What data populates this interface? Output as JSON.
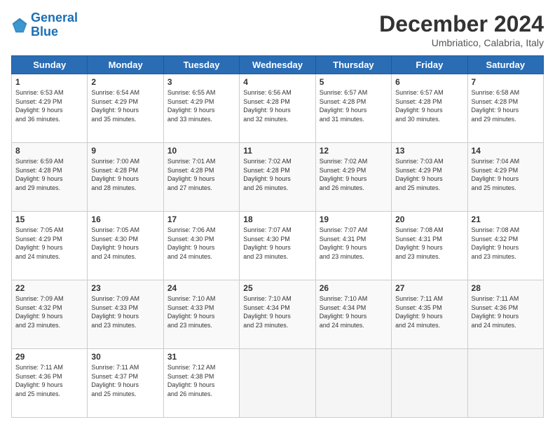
{
  "logo": {
    "line1": "General",
    "line2": "Blue"
  },
  "title": "December 2024",
  "subtitle": "Umbriatico, Calabria, Italy",
  "days_header": [
    "Sunday",
    "Monday",
    "Tuesday",
    "Wednesday",
    "Thursday",
    "Friday",
    "Saturday"
  ],
  "weeks": [
    [
      {
        "day": "1",
        "info": "Sunrise: 6:53 AM\nSunset: 4:29 PM\nDaylight: 9 hours\nand 36 minutes."
      },
      {
        "day": "2",
        "info": "Sunrise: 6:54 AM\nSunset: 4:29 PM\nDaylight: 9 hours\nand 35 minutes."
      },
      {
        "day": "3",
        "info": "Sunrise: 6:55 AM\nSunset: 4:29 PM\nDaylight: 9 hours\nand 33 minutes."
      },
      {
        "day": "4",
        "info": "Sunrise: 6:56 AM\nSunset: 4:28 PM\nDaylight: 9 hours\nand 32 minutes."
      },
      {
        "day": "5",
        "info": "Sunrise: 6:57 AM\nSunset: 4:28 PM\nDaylight: 9 hours\nand 31 minutes."
      },
      {
        "day": "6",
        "info": "Sunrise: 6:57 AM\nSunset: 4:28 PM\nDaylight: 9 hours\nand 30 minutes."
      },
      {
        "day": "7",
        "info": "Sunrise: 6:58 AM\nSunset: 4:28 PM\nDaylight: 9 hours\nand 29 minutes."
      }
    ],
    [
      {
        "day": "8",
        "info": "Sunrise: 6:59 AM\nSunset: 4:28 PM\nDaylight: 9 hours\nand 29 minutes."
      },
      {
        "day": "9",
        "info": "Sunrise: 7:00 AM\nSunset: 4:28 PM\nDaylight: 9 hours\nand 28 minutes."
      },
      {
        "day": "10",
        "info": "Sunrise: 7:01 AM\nSunset: 4:28 PM\nDaylight: 9 hours\nand 27 minutes."
      },
      {
        "day": "11",
        "info": "Sunrise: 7:02 AM\nSunset: 4:28 PM\nDaylight: 9 hours\nand 26 minutes."
      },
      {
        "day": "12",
        "info": "Sunrise: 7:02 AM\nSunset: 4:29 PM\nDaylight: 9 hours\nand 26 minutes."
      },
      {
        "day": "13",
        "info": "Sunrise: 7:03 AM\nSunset: 4:29 PM\nDaylight: 9 hours\nand 25 minutes."
      },
      {
        "day": "14",
        "info": "Sunrise: 7:04 AM\nSunset: 4:29 PM\nDaylight: 9 hours\nand 25 minutes."
      }
    ],
    [
      {
        "day": "15",
        "info": "Sunrise: 7:05 AM\nSunset: 4:29 PM\nDaylight: 9 hours\nand 24 minutes."
      },
      {
        "day": "16",
        "info": "Sunrise: 7:05 AM\nSunset: 4:30 PM\nDaylight: 9 hours\nand 24 minutes."
      },
      {
        "day": "17",
        "info": "Sunrise: 7:06 AM\nSunset: 4:30 PM\nDaylight: 9 hours\nand 24 minutes."
      },
      {
        "day": "18",
        "info": "Sunrise: 7:07 AM\nSunset: 4:30 PM\nDaylight: 9 hours\nand 23 minutes."
      },
      {
        "day": "19",
        "info": "Sunrise: 7:07 AM\nSunset: 4:31 PM\nDaylight: 9 hours\nand 23 minutes."
      },
      {
        "day": "20",
        "info": "Sunrise: 7:08 AM\nSunset: 4:31 PM\nDaylight: 9 hours\nand 23 minutes."
      },
      {
        "day": "21",
        "info": "Sunrise: 7:08 AM\nSunset: 4:32 PM\nDaylight: 9 hours\nand 23 minutes."
      }
    ],
    [
      {
        "day": "22",
        "info": "Sunrise: 7:09 AM\nSunset: 4:32 PM\nDaylight: 9 hours\nand 23 minutes."
      },
      {
        "day": "23",
        "info": "Sunrise: 7:09 AM\nSunset: 4:33 PM\nDaylight: 9 hours\nand 23 minutes."
      },
      {
        "day": "24",
        "info": "Sunrise: 7:10 AM\nSunset: 4:33 PM\nDaylight: 9 hours\nand 23 minutes."
      },
      {
        "day": "25",
        "info": "Sunrise: 7:10 AM\nSunset: 4:34 PM\nDaylight: 9 hours\nand 23 minutes."
      },
      {
        "day": "26",
        "info": "Sunrise: 7:10 AM\nSunset: 4:34 PM\nDaylight: 9 hours\nand 24 minutes."
      },
      {
        "day": "27",
        "info": "Sunrise: 7:11 AM\nSunset: 4:35 PM\nDaylight: 9 hours\nand 24 minutes."
      },
      {
        "day": "28",
        "info": "Sunrise: 7:11 AM\nSunset: 4:36 PM\nDaylight: 9 hours\nand 24 minutes."
      }
    ],
    [
      {
        "day": "29",
        "info": "Sunrise: 7:11 AM\nSunset: 4:36 PM\nDaylight: 9 hours\nand 25 minutes."
      },
      {
        "day": "30",
        "info": "Sunrise: 7:11 AM\nSunset: 4:37 PM\nDaylight: 9 hours\nand 25 minutes."
      },
      {
        "day": "31",
        "info": "Sunrise: 7:12 AM\nSunset: 4:38 PM\nDaylight: 9 hours\nand 26 minutes."
      },
      null,
      null,
      null,
      null
    ]
  ]
}
